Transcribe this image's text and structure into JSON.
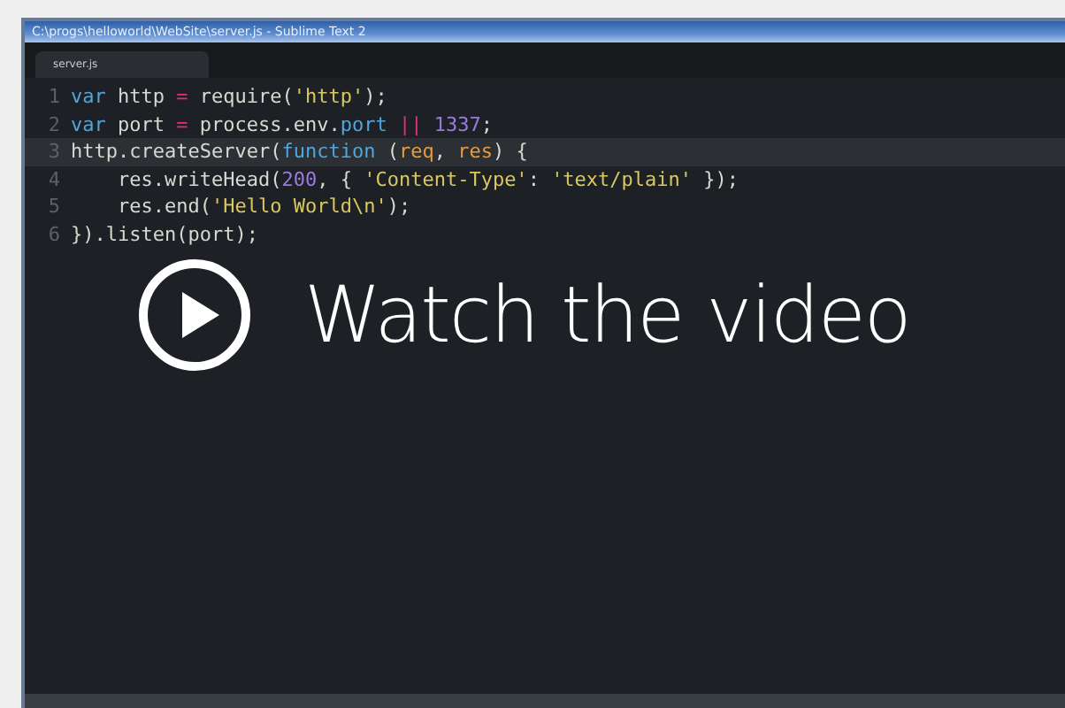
{
  "window": {
    "title": "C:\\progs\\helloworld\\WebSite\\server.js - Sublime Text 2"
  },
  "tabs": [
    {
      "label": "server.js",
      "selected": true
    }
  ],
  "editor": {
    "lines": [
      {
        "number": "1",
        "current": false,
        "tokens": [
          {
            "kind": "keyword",
            "text": "var "
          },
          {
            "kind": "plain",
            "text": "http "
          },
          {
            "kind": "operator",
            "text": "= "
          },
          {
            "kind": "plain",
            "text": "require("
          },
          {
            "kind": "string",
            "text": "'http'"
          },
          {
            "kind": "plain",
            "text": ");"
          }
        ]
      },
      {
        "number": "2",
        "current": false,
        "tokens": [
          {
            "kind": "keyword",
            "text": "var "
          },
          {
            "kind": "plain",
            "text": "port "
          },
          {
            "kind": "operator",
            "text": "= "
          },
          {
            "kind": "plain",
            "text": "process.env."
          },
          {
            "kind": "keyword",
            "text": "port "
          },
          {
            "kind": "operator",
            "text": "|| "
          },
          {
            "kind": "number",
            "text": "1337"
          },
          {
            "kind": "plain",
            "text": ";"
          }
        ]
      },
      {
        "number": "3",
        "current": true,
        "tokens": [
          {
            "kind": "plain",
            "text": "http.createServer("
          },
          {
            "kind": "keyword",
            "text": "function "
          },
          {
            "kind": "plain",
            "text": "("
          },
          {
            "kind": "param",
            "text": "req"
          },
          {
            "kind": "plain",
            "text": ", "
          },
          {
            "kind": "param",
            "text": "res"
          },
          {
            "kind": "plain",
            "text": ") {"
          }
        ]
      },
      {
        "number": "4",
        "current": false,
        "tokens": [
          {
            "kind": "plain",
            "text": "    res.writeHead("
          },
          {
            "kind": "number",
            "text": "200"
          },
          {
            "kind": "plain",
            "text": ", { "
          },
          {
            "kind": "string",
            "text": "'Content-Type'"
          },
          {
            "kind": "plain",
            "text": ": "
          },
          {
            "kind": "string",
            "text": "'text/plain'"
          },
          {
            "kind": "plain",
            "text": " });"
          }
        ]
      },
      {
        "number": "5",
        "current": false,
        "tokens": [
          {
            "kind": "plain",
            "text": "    res.end("
          },
          {
            "kind": "string",
            "text": "'Hello World\\n'"
          },
          {
            "kind": "plain",
            "text": ");"
          }
        ]
      },
      {
        "number": "6",
        "current": false,
        "tokens": [
          {
            "kind": "plain",
            "text": "}).listen(port);"
          }
        ]
      }
    ]
  },
  "overlay": {
    "label": "Watch the video"
  }
}
